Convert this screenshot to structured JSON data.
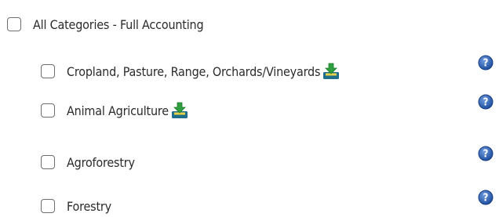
{
  "categories": {
    "all": {
      "label": "All Categories - Full Accounting"
    },
    "items": [
      {
        "label": "Cropland, Pasture, Range, Orchards/Vineyards",
        "download_icon": "download-tray-icon",
        "help_icon": "help-icon"
      },
      {
        "label": "Animal Agriculture",
        "download_icon": "download-tray-icon",
        "help_icon": "help-icon"
      },
      {
        "label": "Agroforestry",
        "help_icon": "help-icon"
      },
      {
        "label": "Forestry",
        "help_icon": "help-icon"
      }
    ]
  },
  "colors": {
    "help_blue": "#2d5fb0",
    "download_green": "#2e9e3e",
    "download_tray": "#1f6f8a"
  }
}
